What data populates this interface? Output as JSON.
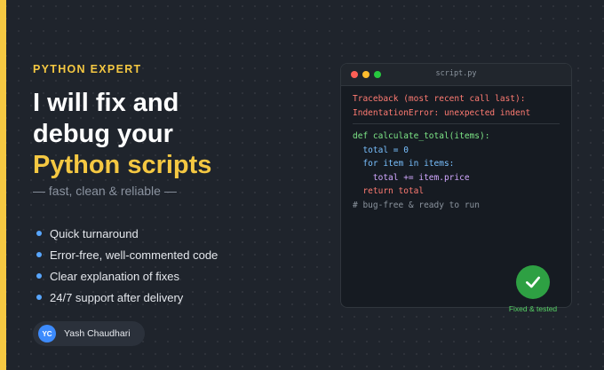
{
  "colors": {
    "accent": "#f5c842",
    "background": "#1f242c",
    "success": "#2ea043",
    "bullet": "#58a6ff"
  },
  "hero": {
    "eyebrow": "PYTHON EXPERT",
    "headline_line1": "I will fix and",
    "headline_line2": "debug your",
    "headline_highlight": "Python scripts",
    "tagline": "— fast, clean & reliable —"
  },
  "features": [
    "Quick turnaround",
    "Error-free, well-commented code",
    "Clear explanation of fixes",
    "24/7 support after delivery"
  ],
  "author": {
    "initials": "YC",
    "name": "Yash Chaudhari"
  },
  "code_window": {
    "title": "script.py",
    "error_lines": [
      "Traceback (most recent call last):",
      "IndentationError: unexpected indent"
    ],
    "code_lines": [
      "def calculate_total(items):",
      "  total = 0",
      "  for item in items:",
      "    total += item.price",
      "  return total",
      "# bug-free & ready to run"
    ]
  },
  "badge": {
    "icon": "checkmark-icon",
    "label": "Fixed & tested"
  }
}
